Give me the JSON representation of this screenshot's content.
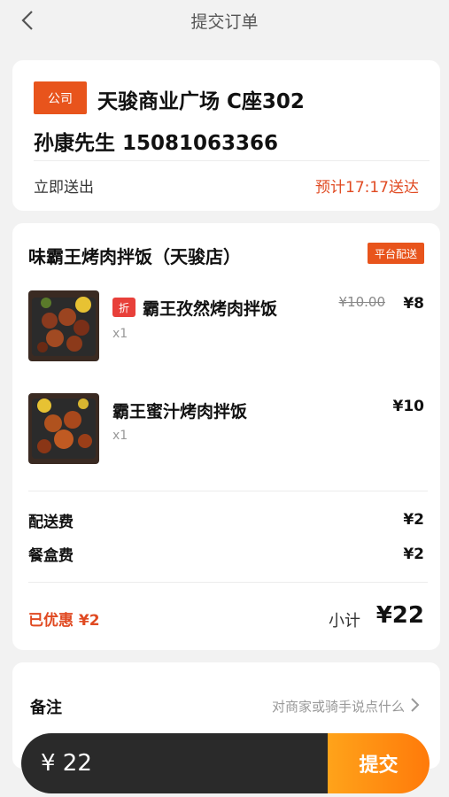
{
  "header": {
    "title": "提交订单",
    "back_icon": "chevron-left-icon"
  },
  "address": {
    "tag": "公司",
    "line": "天骏商业广场 C座302",
    "contact": "孙康先生  15081063366",
    "delivery_mode": "立即送出",
    "eta": "预计17:17送达"
  },
  "order": {
    "shop_name": "味霸王烤肉拌饭（天骏店）",
    "delivery_badge": "平台配送",
    "items": [
      {
        "name": "霸王孜然烤肉拌饭",
        "discount_tag": "折",
        "qty": "x1",
        "old_price": "¥10.00",
        "price": "¥8"
      },
      {
        "name": "霸王蜜汁烤肉拌饭",
        "qty": "x1",
        "price": "¥10"
      }
    ],
    "fees": [
      {
        "label": "配送费",
        "value": "¥2"
      },
      {
        "label": "餐盒费",
        "value": "¥2"
      }
    ],
    "saved": "已优惠 ¥2",
    "subtotal_label": "小计",
    "subtotal": "¥22"
  },
  "notes": {
    "label": "备注",
    "placeholder": "对商家或骑手说点什么"
  },
  "footer": {
    "total": "¥ 22",
    "submit_label": "提交"
  },
  "colors": {
    "accent": "#e8541c",
    "highlight": "#e04a22",
    "submit": "#ff8a10",
    "bar": "#2a2a2a"
  }
}
